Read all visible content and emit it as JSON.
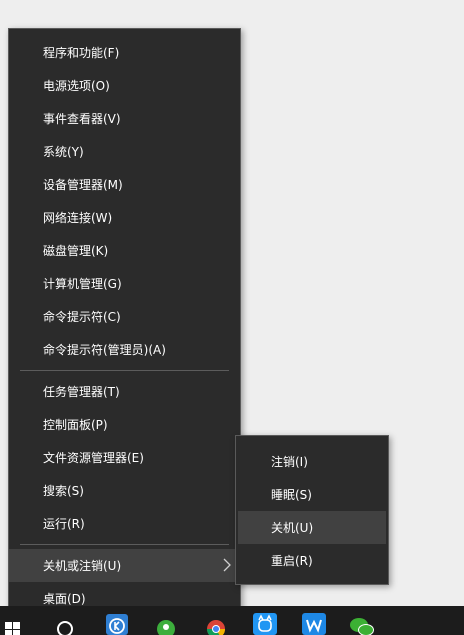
{
  "main_menu": {
    "items": [
      {
        "label": "程序和功能(F)"
      },
      {
        "label": "电源选项(O)"
      },
      {
        "label": "事件查看器(V)"
      },
      {
        "label": "系统(Y)"
      },
      {
        "label": "设备管理器(M)"
      },
      {
        "label": "网络连接(W)"
      },
      {
        "label": "磁盘管理(K)"
      },
      {
        "label": "计算机管理(G)"
      },
      {
        "label": "命令提示符(C)"
      },
      {
        "label": "命令提示符(管理员)(A)"
      },
      {
        "label": "任务管理器(T)"
      },
      {
        "label": "控制面板(P)"
      },
      {
        "label": "文件资源管理器(E)"
      },
      {
        "label": "搜索(S)"
      },
      {
        "label": "运行(R)"
      },
      {
        "label": "关机或注销(U)"
      },
      {
        "label": "桌面(D)"
      }
    ],
    "highlighted": "关机或注销(U)"
  },
  "submenu": {
    "items": [
      {
        "label": "注销(I)"
      },
      {
        "label": "睡眠(S)"
      },
      {
        "label": "关机(U)"
      },
      {
        "label": "重启(R)"
      }
    ],
    "highlighted": "关机(U)"
  },
  "taskbar": {
    "icons": [
      "windows-start-icon",
      "cortana-circle-icon",
      "app-k-icon",
      "green-app-icon",
      "chrome-icon",
      "cat-app-icon",
      "wps-w-icon",
      "wechat-icon"
    ]
  },
  "colors": {
    "menu_bg": "#2b2b2b",
    "hover_bg": "#414141",
    "text": "#ffffff",
    "border": "#5a5a5a"
  }
}
